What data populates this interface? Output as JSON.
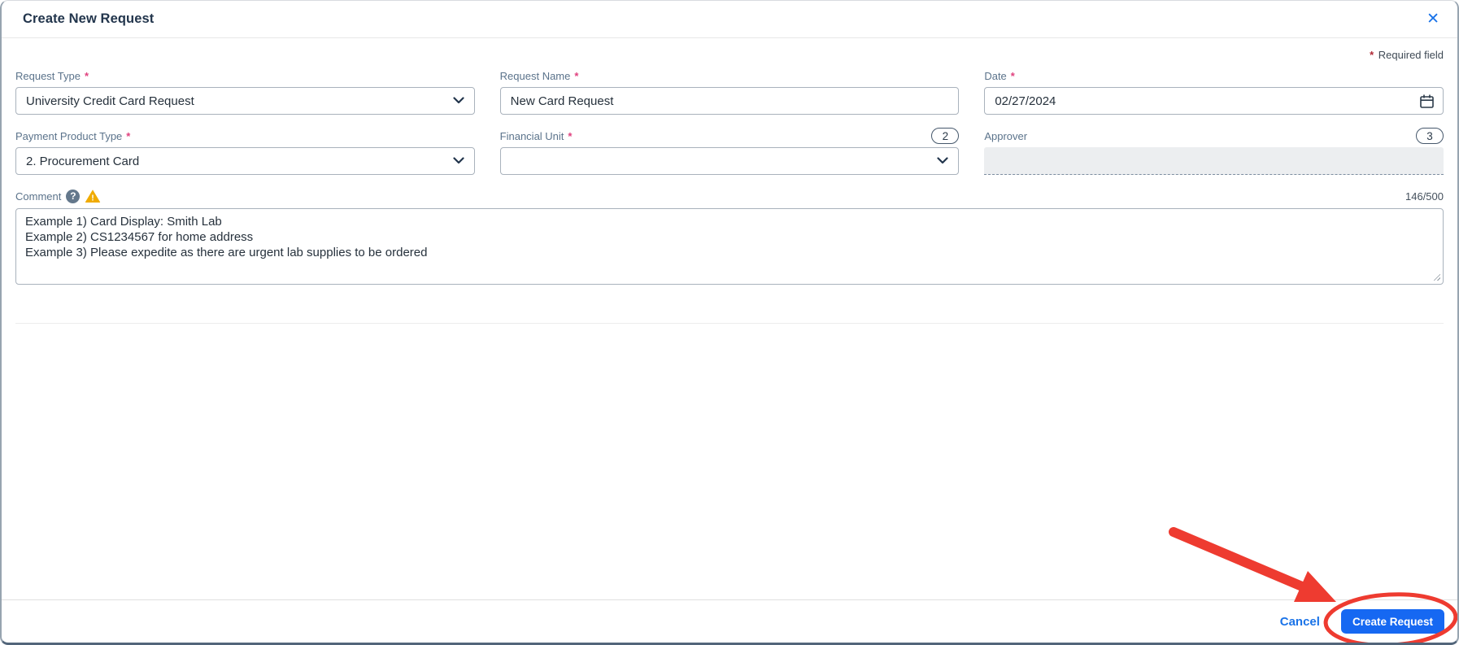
{
  "modal": {
    "title": "Create New Request",
    "close_glyph": "✕",
    "required_marker": "*",
    "required_note": "Required field"
  },
  "form": {
    "request_type": {
      "label": "Request Type",
      "value": "University Credit Card Request"
    },
    "request_name": {
      "label": "Request Name",
      "value": "New Card Request"
    },
    "date": {
      "label": "Date",
      "value": "02/27/2024"
    },
    "payment_product_type": {
      "label": "Payment Product Type",
      "value": "2. Procurement Card"
    },
    "financial_unit": {
      "label": "Financial Unit",
      "value": "",
      "badge": "2"
    },
    "approver": {
      "label": "Approver",
      "value": "",
      "badge": "3"
    },
    "comment": {
      "label": "Comment",
      "help_glyph": "?",
      "warning_glyph": "!",
      "counter": "146/500",
      "value": "Example 1) Card Display: Smith Lab\nExample 2) CS1234567 for home address\nExample 3) Please expedite as there are urgent lab supplies to be ordered"
    }
  },
  "footer": {
    "cancel_label": "Cancel",
    "submit_label": "Create Request"
  },
  "colors": {
    "accent_blue": "#1a73e8",
    "button_blue": "#1668f2",
    "label_slate": "#5b738b",
    "title_navy": "#22354c",
    "required_pink": "#e0417e",
    "warning_amber": "#f0ab00",
    "annotation_red": "#ee3b30",
    "disabled_field_bg": "#eceef0"
  }
}
